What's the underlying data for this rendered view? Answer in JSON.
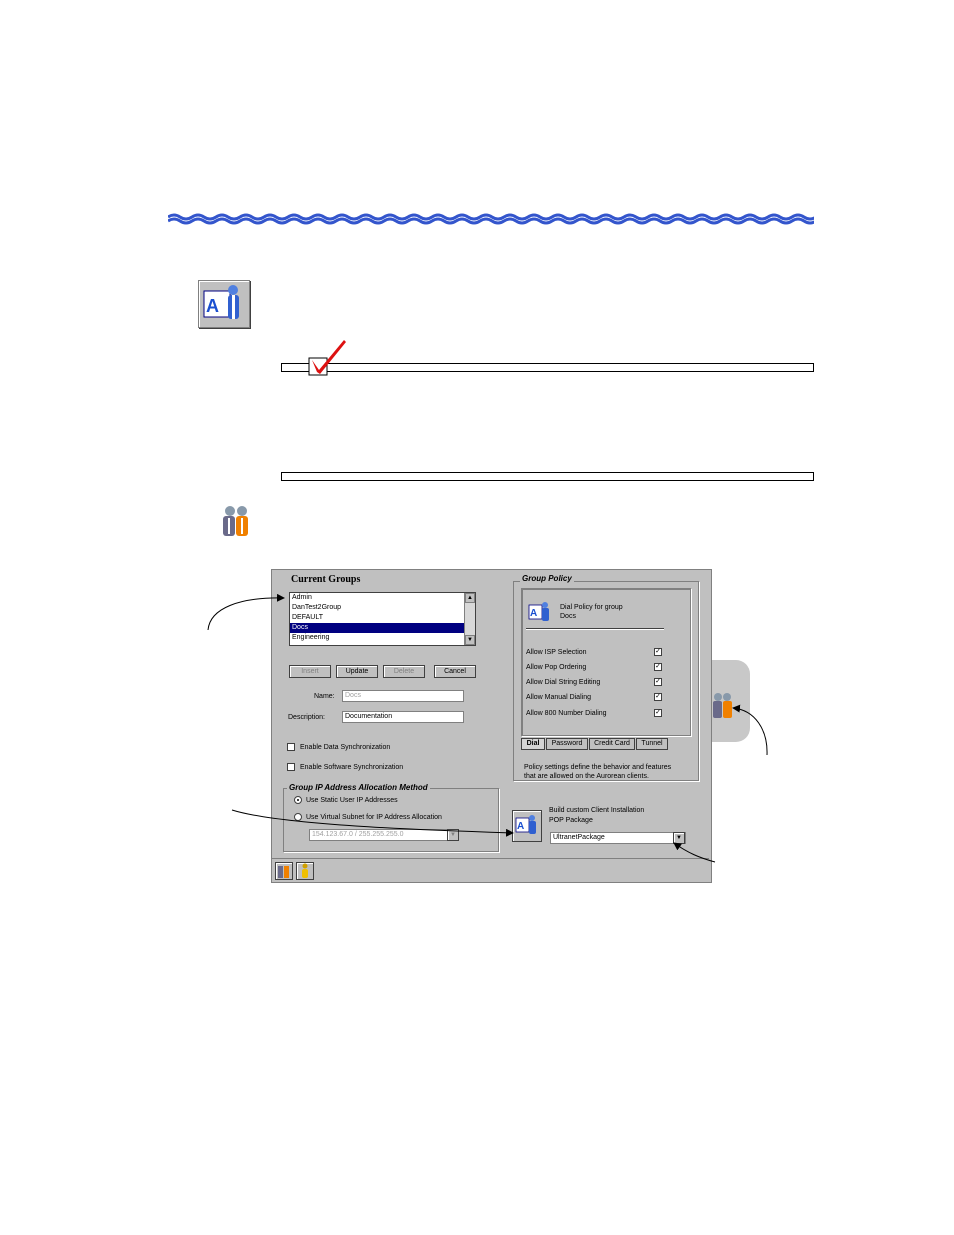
{
  "dialog": {
    "current_groups_title": "Current Groups",
    "groups": [
      "Admin",
      "DanTest2Group",
      "DEFAULT",
      "Docs",
      "Engineering"
    ],
    "selected_group": "Docs",
    "buttons": {
      "new": "Insert",
      "update": "Update",
      "delete": "Delete",
      "cancel": "Cancel"
    },
    "name_label": "Name:",
    "name_value": "Docs",
    "description_label": "Description:",
    "description_value": "Documentation",
    "enable_data_sync": "Enable Data Synchronization",
    "enable_software_sync": "Enable Software Synchronization",
    "ip_section_title": "Group IP Address Allocation Method",
    "use_static": "Use Static User IP Addresses",
    "use_virtual_subnet": "Use Virtual Subnet for IP Address Allocation",
    "subnet_value": "154.123.67.0 / 255.255.255.0",
    "group_policy_title": "Group Policy",
    "policy_header_line1": "Dial Policy for group",
    "policy_header_line2": "Docs",
    "policy_options": [
      {
        "label": "Allow ISP Selection",
        "checked": true
      },
      {
        "label": "Allow Pop Ordering",
        "checked": true
      },
      {
        "label": "Allow Dial String Editing",
        "checked": true
      },
      {
        "label": "Allow Manual Dialing",
        "checked": true
      },
      {
        "label": "Allow 800 Number Dialing",
        "checked": true
      }
    ],
    "tabs": [
      "Dial",
      "Password",
      "Credit Card",
      "Tunnel"
    ],
    "active_tab": "Dial",
    "policy_description": "Policy settings define the behavior and features that are allowed on the Aurorean clients.",
    "build_label_line1": "Build custom Client Installation",
    "build_label_line2": "POP Package",
    "pop_package_value": "UltranetPackage",
    "check_mark": "✓",
    "down_arrow": "▼",
    "up_arrow": "▲"
  },
  "icons": {
    "header_icon": "aurorean-client-icon",
    "check_icon": "red-checkmark-icon",
    "groups_icon": "groups-icon"
  },
  "colors": {
    "wave": "#3355cc",
    "check": "#dd1111",
    "selection": "#000080"
  }
}
